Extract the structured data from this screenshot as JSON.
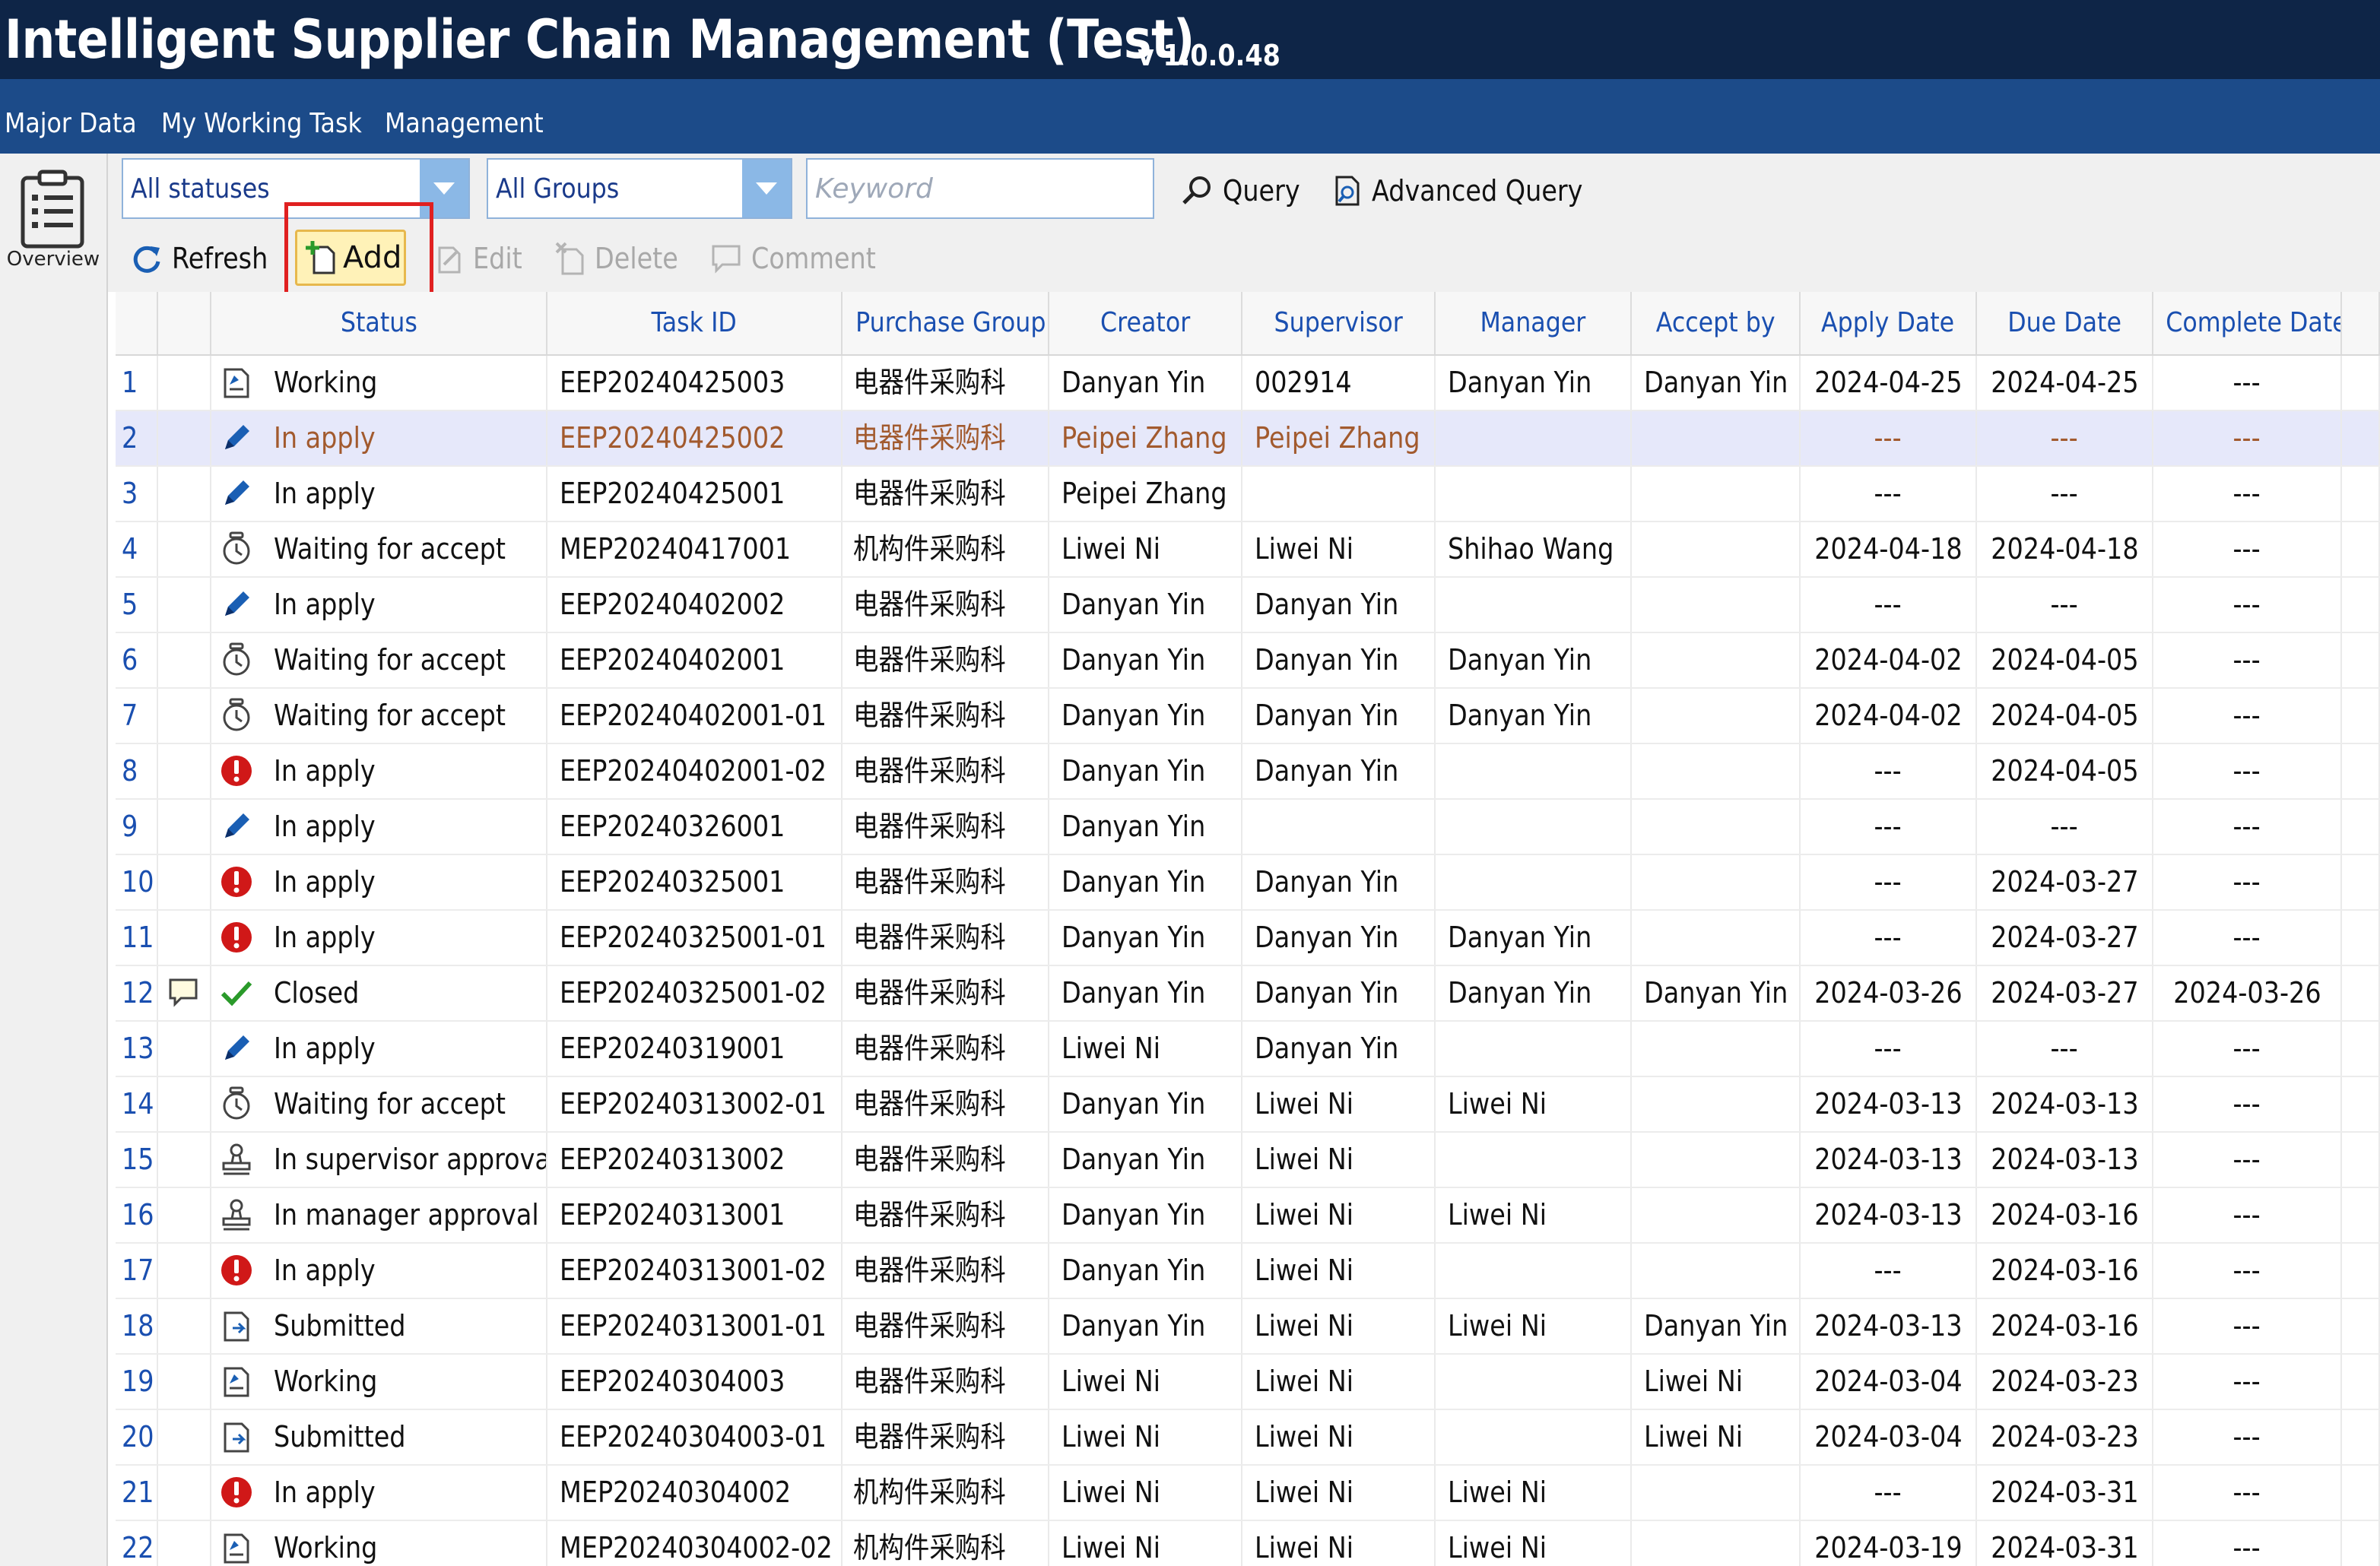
{
  "app": {
    "title": "Intelligent Supplier Chain Management (Test)",
    "version": "v 1.0.0.48"
  },
  "menu": [
    "Major Data",
    "My Working Task",
    "Management"
  ],
  "left_panel": {
    "overview_label": "Overview"
  },
  "filters": {
    "status_select": "All statuses",
    "group_select": "All Groups",
    "keyword_placeholder": "Keyword",
    "query_label": "Query",
    "advanced_query_label": "Advanced Query"
  },
  "toolbar": {
    "refresh_label": "Refresh",
    "add_label": "Add",
    "edit_label": "Edit",
    "delete_label": "Delete",
    "comment_label": "Comment"
  },
  "table": {
    "columns": [
      "Status",
      "Task ID",
      "Purchase Group",
      "Creator",
      "Supervisor",
      "Manager",
      "Accept by",
      "Apply Date",
      "Due Date",
      "Complete Date"
    ],
    "selected_row": 2,
    "rows": [
      {
        "num": "1",
        "comment": false,
        "icon": "working",
        "status": "Working",
        "task_id": "EEP20240425003",
        "group": "电器件采购科",
        "creator": "Danyan Yin",
        "supervisor": "002914",
        "manager": "Danyan Yin",
        "accept_by": "Danyan Yin",
        "apply_date": "2024-04-25",
        "due_date": "2024-04-25",
        "complete_date": "---"
      },
      {
        "num": "2",
        "comment": false,
        "icon": "pencil",
        "status": "In apply",
        "task_id": "EEP20240425002",
        "group": "电器件采购科",
        "creator": "Peipei Zhang",
        "supervisor": "Peipei Zhang",
        "manager": "",
        "accept_by": "",
        "apply_date": "---",
        "due_date": "---",
        "complete_date": "---"
      },
      {
        "num": "3",
        "comment": false,
        "icon": "pencil",
        "status": "In apply",
        "task_id": "EEP20240425001",
        "group": "电器件采购科",
        "creator": "Peipei Zhang",
        "supervisor": "",
        "manager": "",
        "accept_by": "",
        "apply_date": "---",
        "due_date": "---",
        "complete_date": "---"
      },
      {
        "num": "4",
        "comment": false,
        "icon": "clock",
        "status": "Waiting for accept",
        "task_id": "MEP20240417001",
        "group": "机构件采购科",
        "creator": "Liwei Ni",
        "supervisor": "Liwei Ni",
        "manager": "Shihao Wang",
        "accept_by": "",
        "apply_date": "2024-04-18",
        "due_date": "2024-04-18",
        "complete_date": "---"
      },
      {
        "num": "5",
        "comment": false,
        "icon": "pencil",
        "status": "In apply",
        "task_id": "EEP20240402002",
        "group": "电器件采购科",
        "creator": "Danyan Yin",
        "supervisor": "Danyan Yin",
        "manager": "",
        "accept_by": "",
        "apply_date": "---",
        "due_date": "---",
        "complete_date": "---"
      },
      {
        "num": "6",
        "comment": false,
        "icon": "clock",
        "status": "Waiting for accept",
        "task_id": "EEP20240402001",
        "group": "电器件采购科",
        "creator": "Danyan Yin",
        "supervisor": "Danyan Yin",
        "manager": "Danyan Yin",
        "accept_by": "",
        "apply_date": "2024-04-02",
        "due_date": "2024-04-05",
        "complete_date": "---"
      },
      {
        "num": "7",
        "comment": false,
        "icon": "clock",
        "status": "Waiting for accept",
        "task_id": "EEP20240402001-01",
        "group": "电器件采购科",
        "creator": "Danyan Yin",
        "supervisor": "Danyan Yin",
        "manager": "Danyan Yin",
        "accept_by": "",
        "apply_date": "2024-04-02",
        "due_date": "2024-04-05",
        "complete_date": "---"
      },
      {
        "num": "8",
        "comment": false,
        "icon": "alert",
        "status": "In apply",
        "task_id": "EEP20240402001-02",
        "group": "电器件采购科",
        "creator": "Danyan Yin",
        "supervisor": "Danyan Yin",
        "manager": "",
        "accept_by": "",
        "apply_date": "---",
        "due_date": "2024-04-05",
        "complete_date": "---"
      },
      {
        "num": "9",
        "comment": false,
        "icon": "pencil",
        "status": "In apply",
        "task_id": "EEP20240326001",
        "group": "电器件采购科",
        "creator": "Danyan Yin",
        "supervisor": "",
        "manager": "",
        "accept_by": "",
        "apply_date": "---",
        "due_date": "---",
        "complete_date": "---"
      },
      {
        "num": "10",
        "comment": false,
        "icon": "alert",
        "status": "In apply",
        "task_id": "EEP20240325001",
        "group": "电器件采购科",
        "creator": "Danyan Yin",
        "supervisor": "Danyan Yin",
        "manager": "",
        "accept_by": "",
        "apply_date": "---",
        "due_date": "2024-03-27",
        "complete_date": "---"
      },
      {
        "num": "11",
        "comment": false,
        "icon": "alert",
        "status": "In apply",
        "task_id": "EEP20240325001-01",
        "group": "电器件采购科",
        "creator": "Danyan Yin",
        "supervisor": "Danyan Yin",
        "manager": "Danyan Yin",
        "accept_by": "",
        "apply_date": "---",
        "due_date": "2024-03-27",
        "complete_date": "---"
      },
      {
        "num": "12",
        "comment": true,
        "icon": "check",
        "status": "Closed",
        "task_id": "EEP20240325001-02",
        "group": "电器件采购科",
        "creator": "Danyan Yin",
        "supervisor": "Danyan Yin",
        "manager": "Danyan Yin",
        "accept_by": "Danyan Yin",
        "apply_date": "2024-03-26",
        "due_date": "2024-03-27",
        "complete_date": "2024-03-26"
      },
      {
        "num": "13",
        "comment": false,
        "icon": "pencil",
        "status": "In apply",
        "task_id": "EEP20240319001",
        "group": "电器件采购科",
        "creator": "Liwei Ni",
        "supervisor": "Danyan Yin",
        "manager": "",
        "accept_by": "",
        "apply_date": "---",
        "due_date": "---",
        "complete_date": "---"
      },
      {
        "num": "14",
        "comment": false,
        "icon": "clock",
        "status": "Waiting for accept",
        "task_id": "EEP20240313002-01",
        "group": "电器件采购科",
        "creator": "Danyan Yin",
        "supervisor": "Liwei Ni",
        "manager": "Liwei Ni",
        "accept_by": "",
        "apply_date": "2024-03-13",
        "due_date": "2024-03-13",
        "complete_date": "---"
      },
      {
        "num": "15",
        "comment": false,
        "icon": "stamp",
        "status": "In supervisor approval",
        "task_id": "EEP20240313002",
        "group": "电器件采购科",
        "creator": "Danyan Yin",
        "supervisor": "Liwei Ni",
        "manager": "",
        "accept_by": "",
        "apply_date": "2024-03-13",
        "due_date": "2024-03-13",
        "complete_date": "---"
      },
      {
        "num": "16",
        "comment": false,
        "icon": "stamp",
        "status": "In manager approval",
        "task_id": "EEP20240313001",
        "group": "电器件采购科",
        "creator": "Danyan Yin",
        "supervisor": "Liwei Ni",
        "manager": "Liwei Ni",
        "accept_by": "",
        "apply_date": "2024-03-13",
        "due_date": "2024-03-16",
        "complete_date": "---"
      },
      {
        "num": "17",
        "comment": false,
        "icon": "alert",
        "status": "In apply",
        "task_id": "EEP20240313001-02",
        "group": "电器件采购科",
        "creator": "Danyan Yin",
        "supervisor": "Liwei Ni",
        "manager": "",
        "accept_by": "",
        "apply_date": "---",
        "due_date": "2024-03-16",
        "complete_date": "---"
      },
      {
        "num": "18",
        "comment": false,
        "icon": "submitted",
        "status": "Submitted",
        "task_id": "EEP20240313001-01",
        "group": "电器件采购科",
        "creator": "Danyan Yin",
        "supervisor": "Liwei Ni",
        "manager": "Liwei Ni",
        "accept_by": "Danyan Yin",
        "apply_date": "2024-03-13",
        "due_date": "2024-03-16",
        "complete_date": "---"
      },
      {
        "num": "19",
        "comment": false,
        "icon": "working",
        "status": "Working",
        "task_id": "EEP20240304003",
        "group": "电器件采购科",
        "creator": "Liwei Ni",
        "supervisor": "Liwei Ni",
        "manager": "",
        "accept_by": "Liwei Ni",
        "apply_date": "2024-03-04",
        "due_date": "2024-03-23",
        "complete_date": "---"
      },
      {
        "num": "20",
        "comment": false,
        "icon": "submitted",
        "status": "Submitted",
        "task_id": "EEP20240304003-01",
        "group": "电器件采购科",
        "creator": "Liwei Ni",
        "supervisor": "Liwei Ni",
        "manager": "",
        "accept_by": "Liwei Ni",
        "apply_date": "2024-03-04",
        "due_date": "2024-03-23",
        "complete_date": "---"
      },
      {
        "num": "21",
        "comment": false,
        "icon": "alert",
        "status": "In apply",
        "task_id": "MEP20240304002",
        "group": "机构件采购科",
        "creator": "Liwei Ni",
        "supervisor": "Liwei Ni",
        "manager": "Liwei Ni",
        "accept_by": "",
        "apply_date": "---",
        "due_date": "2024-03-31",
        "complete_date": "---"
      },
      {
        "num": "22",
        "comment": false,
        "icon": "working",
        "status": "Working",
        "task_id": "MEP20240304002-02",
        "group": "机构件采购科",
        "creator": "Liwei Ni",
        "supervisor": "Liwei Ni",
        "manager": "Liwei Ni",
        "accept_by": "",
        "apply_date": "2024-03-19",
        "due_date": "2024-03-31",
        "complete_date": "---"
      }
    ]
  },
  "colors": {
    "title_bar": "#0e2547",
    "menu_bar": "#1c4b89",
    "header_text": "#1a4fb0",
    "selected_row_bg": "#e6e8fa",
    "selected_row_text": "#a25a2e",
    "add_button_bg": "#fff2b8",
    "highlight_box": "#e02020"
  }
}
